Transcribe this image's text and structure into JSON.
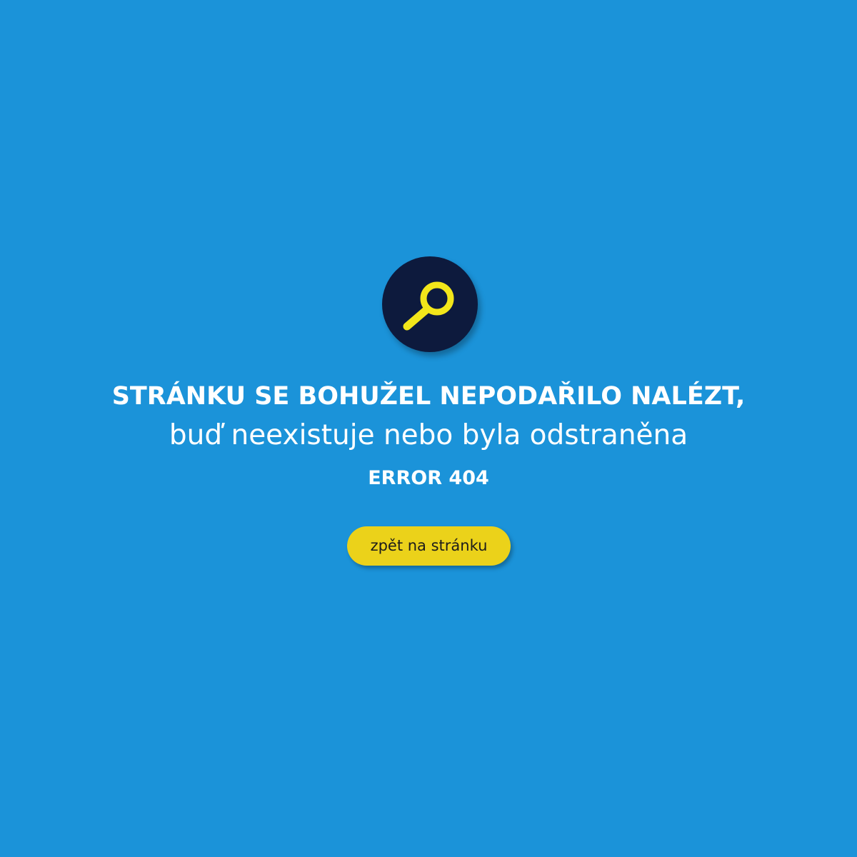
{
  "error_page": {
    "headline": "STRÁNKU SE BOHUŽEL NEPODAŘILO NALÉZT,",
    "subline": "buď neexistuje nebo byla odstraněna",
    "error_code": "ERROR 404",
    "back_button_label": "zpět na stránku",
    "icon": "search-icon"
  },
  "colors": {
    "background": "#1b93d9",
    "icon_circle": "#0d1a3d",
    "icon_glyph": "#f2e61a",
    "button": "#ebd21a",
    "text": "#ffffff"
  }
}
